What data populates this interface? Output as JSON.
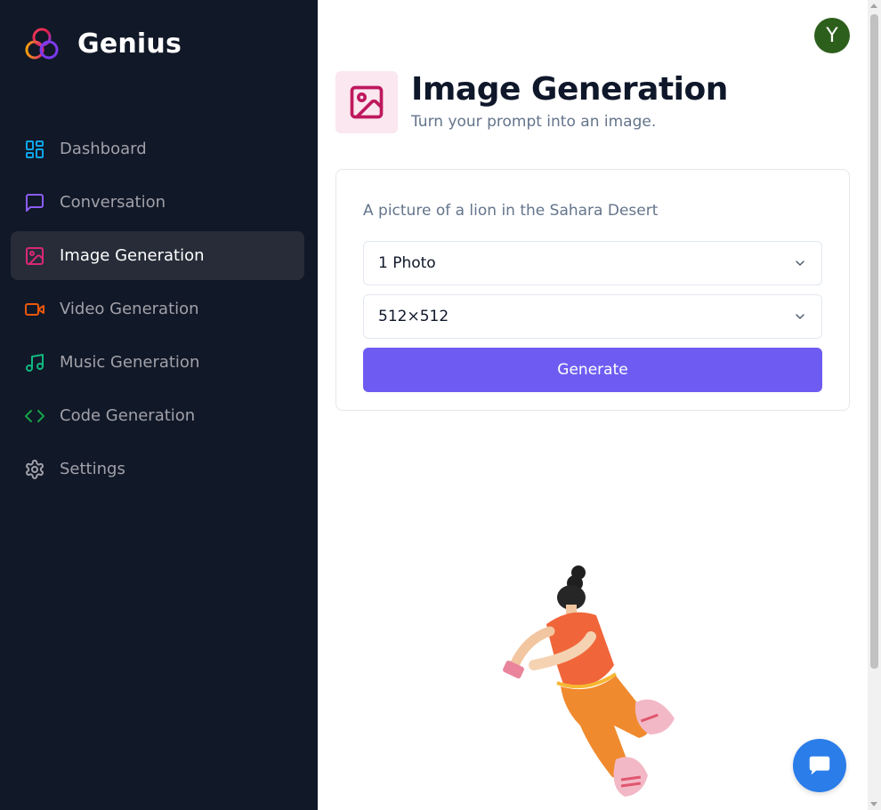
{
  "app": {
    "name": "Genius"
  },
  "sidebar": {
    "items": [
      {
        "label": "Dashboard",
        "icon": "dashboard-icon",
        "color": "#0ea5e9",
        "active": false
      },
      {
        "label": "Conversation",
        "icon": "message-square-icon",
        "color": "#8b5cf6",
        "active": false
      },
      {
        "label": "Image Generation",
        "icon": "image-icon",
        "color": "#db2777",
        "active": true
      },
      {
        "label": "Video Generation",
        "icon": "video-icon",
        "color": "#ea580c",
        "active": false
      },
      {
        "label": "Music Generation",
        "icon": "music-icon",
        "color": "#10b981",
        "active": false
      },
      {
        "label": "Code Generation",
        "icon": "code-icon",
        "color": "#16a34a",
        "active": false
      },
      {
        "label": "Settings",
        "icon": "settings-icon",
        "color": "#a1a1aa",
        "active": false
      }
    ]
  },
  "user": {
    "avatar_initial": "Y"
  },
  "page": {
    "title": "Image Generation",
    "subtitle": "Turn your prompt into an image.",
    "icon": "image-icon"
  },
  "form": {
    "prompt_placeholder": "A picture of a lion in the Sahara Desert",
    "prompt_value": "",
    "amount": {
      "selected": "1 Photo"
    },
    "resolution": {
      "selected": "512×512"
    },
    "generate_label": "Generate"
  },
  "empty_state": {
    "illustration": "floating-person-with-phone"
  },
  "chat_widget": {
    "icon": "chat-bubble-icon"
  },
  "colors": {
    "sidebar_bg": "#111827",
    "active_item_bg": "#272c38",
    "generate_button": "#6e5cf2",
    "page_icon_bg": "#fbe7ef",
    "page_icon": "#be185d",
    "avatar_bg": "#2d5f1c",
    "chat_button": "#2b7de9"
  }
}
